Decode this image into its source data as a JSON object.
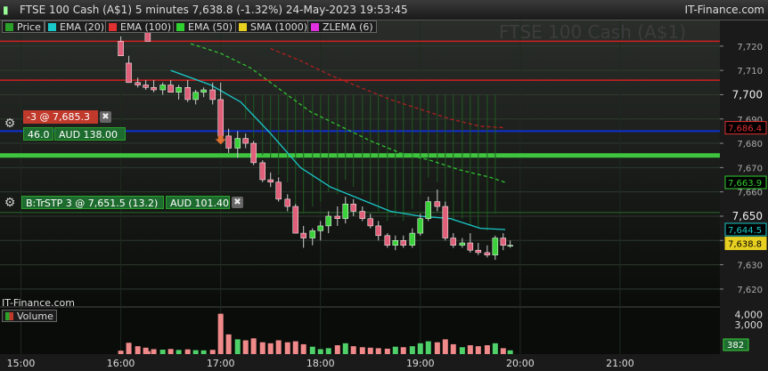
{
  "header": {
    "title": "FTSE 100 Cash (A$1) 5 minutes 7,638.8 (-1.32%) 24-May-2023 19:53:45",
    "brand": "IT-Finance.com"
  },
  "legend": [
    {
      "label": "Price",
      "color": "#2aa02a"
    },
    {
      "label": "EMA (20)",
      "color": "#19c9c9"
    },
    {
      "label": "EMA (100)",
      "color": "#e03030"
    },
    {
      "label": "EMA (50)",
      "color": "#30d030"
    },
    {
      "label": "SMA (1000)",
      "color": "#e8d020"
    },
    {
      "label": "ZLEMA (6)",
      "color": "#e030e0"
    }
  ],
  "watermark": "FTSE 100 Cash (A$1)",
  "orders": {
    "sell": {
      "label": "-3 @ 7,685.3",
      "distance": "46.0",
      "pnl": "AUD 138.00"
    },
    "stop": {
      "label": "B:TrSTP  3 @ 7,651.5 (13.2)",
      "pnl": "AUD 101.40"
    }
  },
  "footer_brand": "IT-Finance.com",
  "volume_label": "Volume",
  "chart_data": {
    "type": "candlestick",
    "title": "FTSE 100 Cash (A$1) 5 minutes",
    "price_axis": {
      "ylim": [
        7613,
        7728
      ],
      "ticks": [
        7620,
        7630,
        7640,
        7650,
        7660,
        7670,
        7680,
        7690,
        7700,
        7710,
        7720
      ],
      "tick_labels": [
        "7,620",
        "7,630",
        "7,640",
        "7,650",
        "7,660",
        "7,670",
        "7,680",
        "7,690",
        "7,700",
        "7,710",
        "7,720"
      ]
    },
    "volume_axis": {
      "ylim": [
        0,
        4700
      ],
      "ticks": [
        3000,
        4000
      ],
      "tick_labels": [
        "3,000",
        "4,000"
      ],
      "last_value": "382"
    },
    "x_axis": {
      "tick_labels": [
        "15:00",
        "16:00",
        "17:00",
        "18:00",
        "19:00",
        "20:00",
        "21:00"
      ],
      "tick_hours": [
        15,
        16,
        17,
        18,
        19,
        20,
        21
      ],
      "range_hours": [
        14.79,
        22.0
      ]
    },
    "candles": [
      {
        "t": 16.27,
        "o": 7728,
        "h": 7729,
        "l": 7722,
        "c": 7722,
        "v": 300
      },
      {
        "t": 16.0,
        "o": 7722,
        "h": 7724,
        "l": 7716,
        "c": 7716,
        "v": 350
      },
      {
        "t": 16.08,
        "o": 7713,
        "h": 7716,
        "l": 7705,
        "c": 7705,
        "v": 1150
      },
      {
        "t": 16.17,
        "o": 7705,
        "h": 7707,
        "l": 7703,
        "c": 7704,
        "v": 800
      },
      {
        "t": 16.25,
        "o": 7704,
        "h": 7706,
        "l": 7702,
        "c": 7703,
        "v": 650
      },
      {
        "t": 16.33,
        "o": 7703,
        "h": 7706,
        "l": 7701,
        "c": 7702,
        "v": 500
      },
      {
        "t": 16.42,
        "o": 7702,
        "h": 7705,
        "l": 7700,
        "c": 7704,
        "v": 450
      },
      {
        "t": 16.5,
        "o": 7704,
        "h": 7706,
        "l": 7701,
        "c": 7701,
        "v": 520
      },
      {
        "t": 16.58,
        "o": 7701,
        "h": 7704,
        "l": 7698,
        "c": 7703,
        "v": 420
      },
      {
        "t": 16.67,
        "o": 7703,
        "h": 7706,
        "l": 7697,
        "c": 7698,
        "v": 480
      },
      {
        "t": 16.75,
        "o": 7698,
        "h": 7702,
        "l": 7696,
        "c": 7701,
        "v": 400
      },
      {
        "t": 16.83,
        "o": 7701,
        "h": 7703,
        "l": 7699,
        "c": 7702,
        "v": 380
      },
      {
        "t": 16.92,
        "o": 7702,
        "h": 7705,
        "l": 7696,
        "c": 7698,
        "v": 430
      },
      {
        "t": 17.0,
        "o": 7698,
        "h": 7705,
        "l": 7682,
        "c": 7683,
        "v": 4100
      },
      {
        "t": 17.08,
        "o": 7683,
        "h": 7686,
        "l": 7676,
        "c": 7678,
        "v": 2000
      },
      {
        "t": 17.17,
        "o": 7678,
        "h": 7685,
        "l": 7674,
        "c": 7682,
        "v": 1500
      },
      {
        "t": 17.25,
        "o": 7682,
        "h": 7684,
        "l": 7678,
        "c": 7680,
        "v": 1400
      },
      {
        "t": 17.33,
        "o": 7680,
        "h": 7681,
        "l": 7671,
        "c": 7672,
        "v": 1600
      },
      {
        "t": 17.42,
        "o": 7672,
        "h": 7673,
        "l": 7664,
        "c": 7665,
        "v": 1200
      },
      {
        "t": 17.5,
        "o": 7665,
        "h": 7668,
        "l": 7662,
        "c": 7664,
        "v": 1100
      },
      {
        "t": 17.58,
        "o": 7664,
        "h": 7666,
        "l": 7656,
        "c": 7657,
        "v": 1400
      },
      {
        "t": 17.67,
        "o": 7657,
        "h": 7659,
        "l": 7652,
        "c": 7654,
        "v": 1200
      },
      {
        "t": 17.75,
        "o": 7654,
        "h": 7655,
        "l": 7643,
        "c": 7643,
        "v": 1300
      },
      {
        "t": 17.83,
        "o": 7643,
        "h": 7646,
        "l": 7637,
        "c": 7641,
        "v": 1000
      },
      {
        "t": 17.92,
        "o": 7641,
        "h": 7645,
        "l": 7638,
        "c": 7644,
        "v": 750
      },
      {
        "t": 18.0,
        "o": 7644,
        "h": 7648,
        "l": 7640,
        "c": 7646,
        "v": 500
      },
      {
        "t": 18.08,
        "o": 7646,
        "h": 7652,
        "l": 7643,
        "c": 7650,
        "v": 600
      },
      {
        "t": 18.17,
        "o": 7650,
        "h": 7654,
        "l": 7646,
        "c": 7649,
        "v": 900
      },
      {
        "t": 18.25,
        "o": 7649,
        "h": 7658,
        "l": 7647,
        "c": 7655,
        "v": 1100
      },
      {
        "t": 18.33,
        "o": 7655,
        "h": 7657,
        "l": 7650,
        "c": 7652,
        "v": 800
      },
      {
        "t": 18.42,
        "o": 7652,
        "h": 7654,
        "l": 7648,
        "c": 7649,
        "v": 700
      },
      {
        "t": 18.5,
        "o": 7649,
        "h": 7651,
        "l": 7645,
        "c": 7646,
        "v": 650
      },
      {
        "t": 18.58,
        "o": 7646,
        "h": 7648,
        "l": 7640,
        "c": 7642,
        "v": 600
      },
      {
        "t": 18.67,
        "o": 7642,
        "h": 7643,
        "l": 7637,
        "c": 7638,
        "v": 550
      },
      {
        "t": 18.75,
        "o": 7638,
        "h": 7642,
        "l": 7636,
        "c": 7640,
        "v": 750
      },
      {
        "t": 18.83,
        "o": 7640,
        "h": 7642,
        "l": 7637,
        "c": 7638,
        "v": 700
      },
      {
        "t": 18.92,
        "o": 7638,
        "h": 7645,
        "l": 7637,
        "c": 7643,
        "v": 800
      },
      {
        "t": 19.0,
        "o": 7643,
        "h": 7651,
        "l": 7642,
        "c": 7649,
        "v": 1100
      },
      {
        "t": 19.08,
        "o": 7649,
        "h": 7658,
        "l": 7648,
        "c": 7656,
        "v": 1300
      },
      {
        "t": 19.17,
        "o": 7656,
        "h": 7661,
        "l": 7652,
        "c": 7654,
        "v": 1200
      },
      {
        "t": 19.25,
        "o": 7654,
        "h": 7656,
        "l": 7640,
        "c": 7641,
        "v": 1500
      },
      {
        "t": 19.33,
        "o": 7641,
        "h": 7643,
        "l": 7637,
        "c": 7638,
        "v": 1000
      },
      {
        "t": 19.42,
        "o": 7638,
        "h": 7641,
        "l": 7637,
        "c": 7639,
        "v": 700
      },
      {
        "t": 19.5,
        "o": 7639,
        "h": 7643,
        "l": 7635,
        "c": 7636,
        "v": 900
      },
      {
        "t": 19.58,
        "o": 7636,
        "h": 7639,
        "l": 7634,
        "c": 7635,
        "v": 800
      },
      {
        "t": 19.67,
        "o": 7635,
        "h": 7638,
        "l": 7633,
        "c": 7634,
        "v": 900
      },
      {
        "t": 19.75,
        "o": 7634,
        "h": 7642,
        "l": 7632,
        "c": 7641,
        "v": 1100
      },
      {
        "t": 19.83,
        "o": 7641,
        "h": 7643,
        "l": 7636,
        "c": 7638,
        "v": 600
      },
      {
        "t": 19.9,
        "o": 7638,
        "h": 7640,
        "l": 7637,
        "c": 7638,
        "v": 382
      }
    ],
    "indicators": {
      "ema20": [
        [
          16.5,
          7710
        ],
        [
          16.9,
          7704
        ],
        [
          17.2,
          7697
        ],
        [
          17.5,
          7684
        ],
        [
          17.8,
          7670
        ],
        [
          18.1,
          7662
        ],
        [
          18.4,
          7657
        ],
        [
          18.7,
          7652
        ],
        [
          19.0,
          7650
        ],
        [
          19.3,
          7649
        ],
        [
          19.6,
          7645
        ],
        [
          19.85,
          7644.5
        ]
      ],
      "ema50": [
        [
          16.7,
          7721
        ],
        [
          17.0,
          7717
        ],
        [
          17.3,
          7711
        ],
        [
          17.6,
          7702
        ],
        [
          17.9,
          7693
        ],
        [
          18.2,
          7687
        ],
        [
          18.5,
          7681
        ],
        [
          18.8,
          7676
        ],
        [
          19.1,
          7673
        ],
        [
          19.4,
          7669
        ],
        [
          19.7,
          7666
        ],
        [
          19.85,
          7663.9
        ]
      ],
      "ema100": [
        [
          17.5,
          7719
        ],
        [
          17.8,
          7714
        ],
        [
          18.1,
          7708
        ],
        [
          18.4,
          7703
        ],
        [
          18.7,
          7698
        ],
        [
          19.0,
          7694
        ],
        [
          19.3,
          7690
        ],
        [
          19.6,
          7687
        ],
        [
          19.85,
          7686.4
        ]
      ],
      "lines": {
        "ema100_last": 7686.4,
        "blue_level": 7685,
        "green_band": 7675,
        "red_top": 7722,
        "red_mid": 7706
      }
    },
    "price_labels": [
      {
        "value": "7,686.4",
        "color": "#e03030"
      },
      {
        "value": "7,663.9",
        "color": "#30d030"
      },
      {
        "value": "7,644.5",
        "color": "#19c9c9"
      },
      {
        "value": "7,638.8",
        "color": "#e8d020"
      }
    ]
  }
}
